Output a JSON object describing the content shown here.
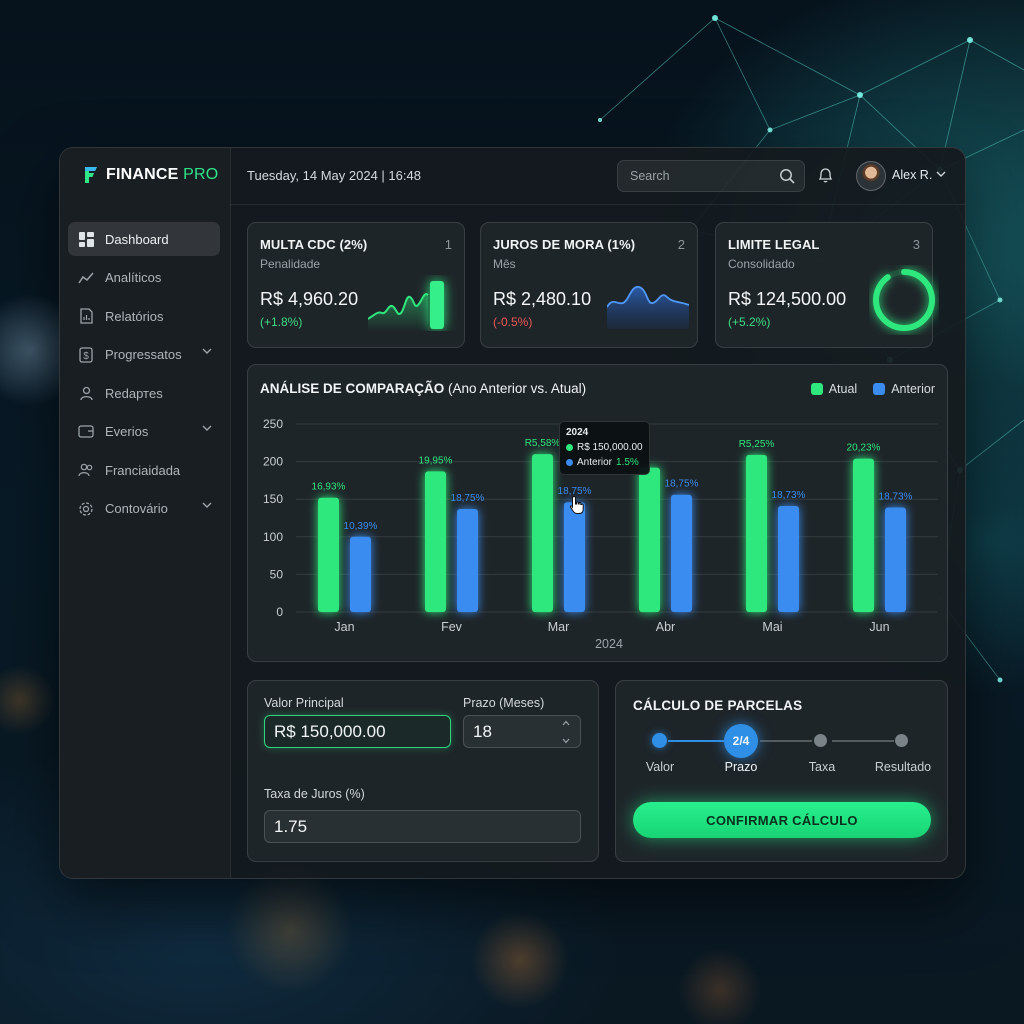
{
  "brand": {
    "name": "FINANCE",
    "suffix": "PRO",
    "accent": "#2ee58a"
  },
  "sidebar": {
    "items": [
      {
        "label": "Dashboard",
        "icon": "dashboard-icon",
        "active": true
      },
      {
        "label": "Analíticos",
        "icon": "analytics-icon"
      },
      {
        "label": "Relatórios",
        "icon": "report-icon"
      },
      {
        "label": "Progressatos",
        "icon": "dollar-icon",
        "expandable": true
      },
      {
        "label": "Redaртes",
        "icon": "user-group-icon"
      },
      {
        "label": "Everios",
        "icon": "wallet-icon",
        "expandable": true
      },
      {
        "label": "Franciaidada",
        "icon": "people-icon"
      },
      {
        "label": "Contovário",
        "icon": "gear-icon",
        "expandable": true
      }
    ]
  },
  "header": {
    "datetime": "Tuesday, 14 May 2024 | 16:48",
    "search_placeholder": "Search",
    "user_name": "Alex R."
  },
  "kpis": [
    {
      "title": "MULTA CDC (2%)",
      "subtitle": "Penalidade",
      "index": "1",
      "value": "R$ 4,960.20",
      "change": "(+1.8%)",
      "trend": "positive"
    },
    {
      "title": "JUROS DE MORA (1%)",
      "subtitle": "Mês",
      "index": "2",
      "value": "R$ 2,480.10",
      "change": "(-0.5%)",
      "trend": "negative"
    },
    {
      "title": "LIMITE LEGAL",
      "subtitle": "Consolidado",
      "index": "3",
      "value": "R$ 124,500.00",
      "change": "(+5.2%)",
      "trend": "positive",
      "ring_fraction": 0.9
    }
  ],
  "comparison": {
    "title_bold": "ANÁLISE DE COMPARAÇÃO",
    "title_rest": "(Ano Anterior vs. Atual)",
    "tooltip": {
      "year": "2024",
      "current": "R$ 150,000.00",
      "previous_label": "Anterior",
      "previous_value": "1.5%"
    }
  },
  "chart_data": {
    "type": "bar",
    "categories": [
      "Jan",
      "Fev",
      "Mar",
      "Abr",
      "Mai",
      "Jun"
    ],
    "xlabel": "2024",
    "ylabel": "",
    "ylim": [
      0,
      250
    ],
    "yticks": [
      0,
      50,
      100,
      150,
      200,
      250
    ],
    "grid": true,
    "legend_position": "top-right",
    "series": [
      {
        "name": "Atual",
        "color": "#2ee87d",
        "values": [
          152,
          187,
          210,
          192,
          209,
          204
        ],
        "labels": [
          "16,93%",
          "19,95%",
          "R5,58%",
          "",
          "R5,25%",
          "20,23%"
        ]
      },
      {
        "name": "Anterior",
        "color": "#3a8cf0",
        "values": [
          100,
          137,
          146,
          156,
          141,
          139
        ],
        "labels": [
          "10,39%",
          "18,75%",
          "18,75%",
          "18,75%",
          "18,73%",
          "18,73%"
        ]
      }
    ]
  },
  "form": {
    "principal_label": "Valor Principal",
    "principal_value": "R$ 150,000.00",
    "term_label": "Prazo (Meses)",
    "term_value": "18",
    "rate_label": "Taxa de Juros (%)",
    "rate_value": "1.75"
  },
  "calculator": {
    "title": "CÁLCULO DE PARCELAS",
    "current_step": "2/4",
    "steps": [
      "Valor",
      "Prazo",
      "Taxa",
      "Resultado"
    ],
    "confirm_label": "CONFIRMAR CÁLCULO"
  }
}
